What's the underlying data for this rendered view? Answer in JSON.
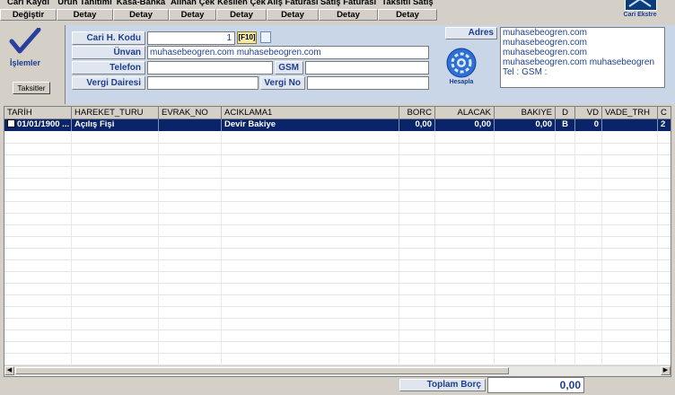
{
  "toolbar": {
    "items": [
      {
        "label": "Cari Kaydı",
        "button": "Değiştir"
      },
      {
        "label": "Ürün Tanıtımı",
        "button": "Detay"
      },
      {
        "label": "Kasa-Banka",
        "button": "Detay"
      },
      {
        "label": "Alınan Çek",
        "button": "Detay"
      },
      {
        "label": "Kesilen Çek",
        "button": "Detay"
      },
      {
        "label": "Alış Faturası",
        "button": "Detay"
      },
      {
        "label": "Satış Faturası",
        "button": "Detay"
      },
      {
        "label": "Taksitli Satış",
        "button": "Detay"
      }
    ],
    "logo_label": "Cari Ekstre"
  },
  "left_panel": {
    "islemler": "İşlemler",
    "taksitler": "Taksitler"
  },
  "form": {
    "cari_kodu_label": "Cari H. Kodu",
    "cari_kodu_value": "1",
    "f10_label": "[F10]",
    "unvan_label": "Ünvan",
    "unvan_value": "muhasebeogren.com    muhasebeogren.com",
    "telefon_label": "Telefon",
    "telefon_value": "",
    "gsm_label": "GSM",
    "gsm_value": "",
    "vergi_dairesi_label": "Vergi Dairesi",
    "vergi_dairesi_value": "",
    "vergi_no_label": "Vergi  No",
    "vergi_no_value": "",
    "adres_label": "Adres",
    "hesapla_label": "Hesapla",
    "adres_lines": [
      "muhasebeogren.com",
      "muhasebeogren.com",
      "muhasebeogren.com",
      "muhasebeogren.com    muhasebeogren",
      "  Tel :  GSM :"
    ]
  },
  "grid": {
    "columns": [
      "TARİH",
      "HAREKET_TURU",
      "EVRAK_NO",
      "ACIKLAMA1",
      "BORC",
      "ALACAK",
      "BAKIYE",
      "D",
      "VD",
      "VADE_TRH",
      "C"
    ],
    "rows": [
      [
        "01/01/1900 ...",
        "Açılış Fişi",
        "",
        "Devir Bakiye",
        "0,00",
        "0,00",
        "0,00",
        "B",
        "0",
        "",
        "2"
      ]
    ]
  },
  "footer": {
    "toplam_borc_label": "Toplam Borç",
    "toplam_borc_value": "0,00"
  },
  "colors": {
    "selection": "#0a246a",
    "label_text": "#1f3f8a",
    "form_bg": "#c8d6e8"
  }
}
